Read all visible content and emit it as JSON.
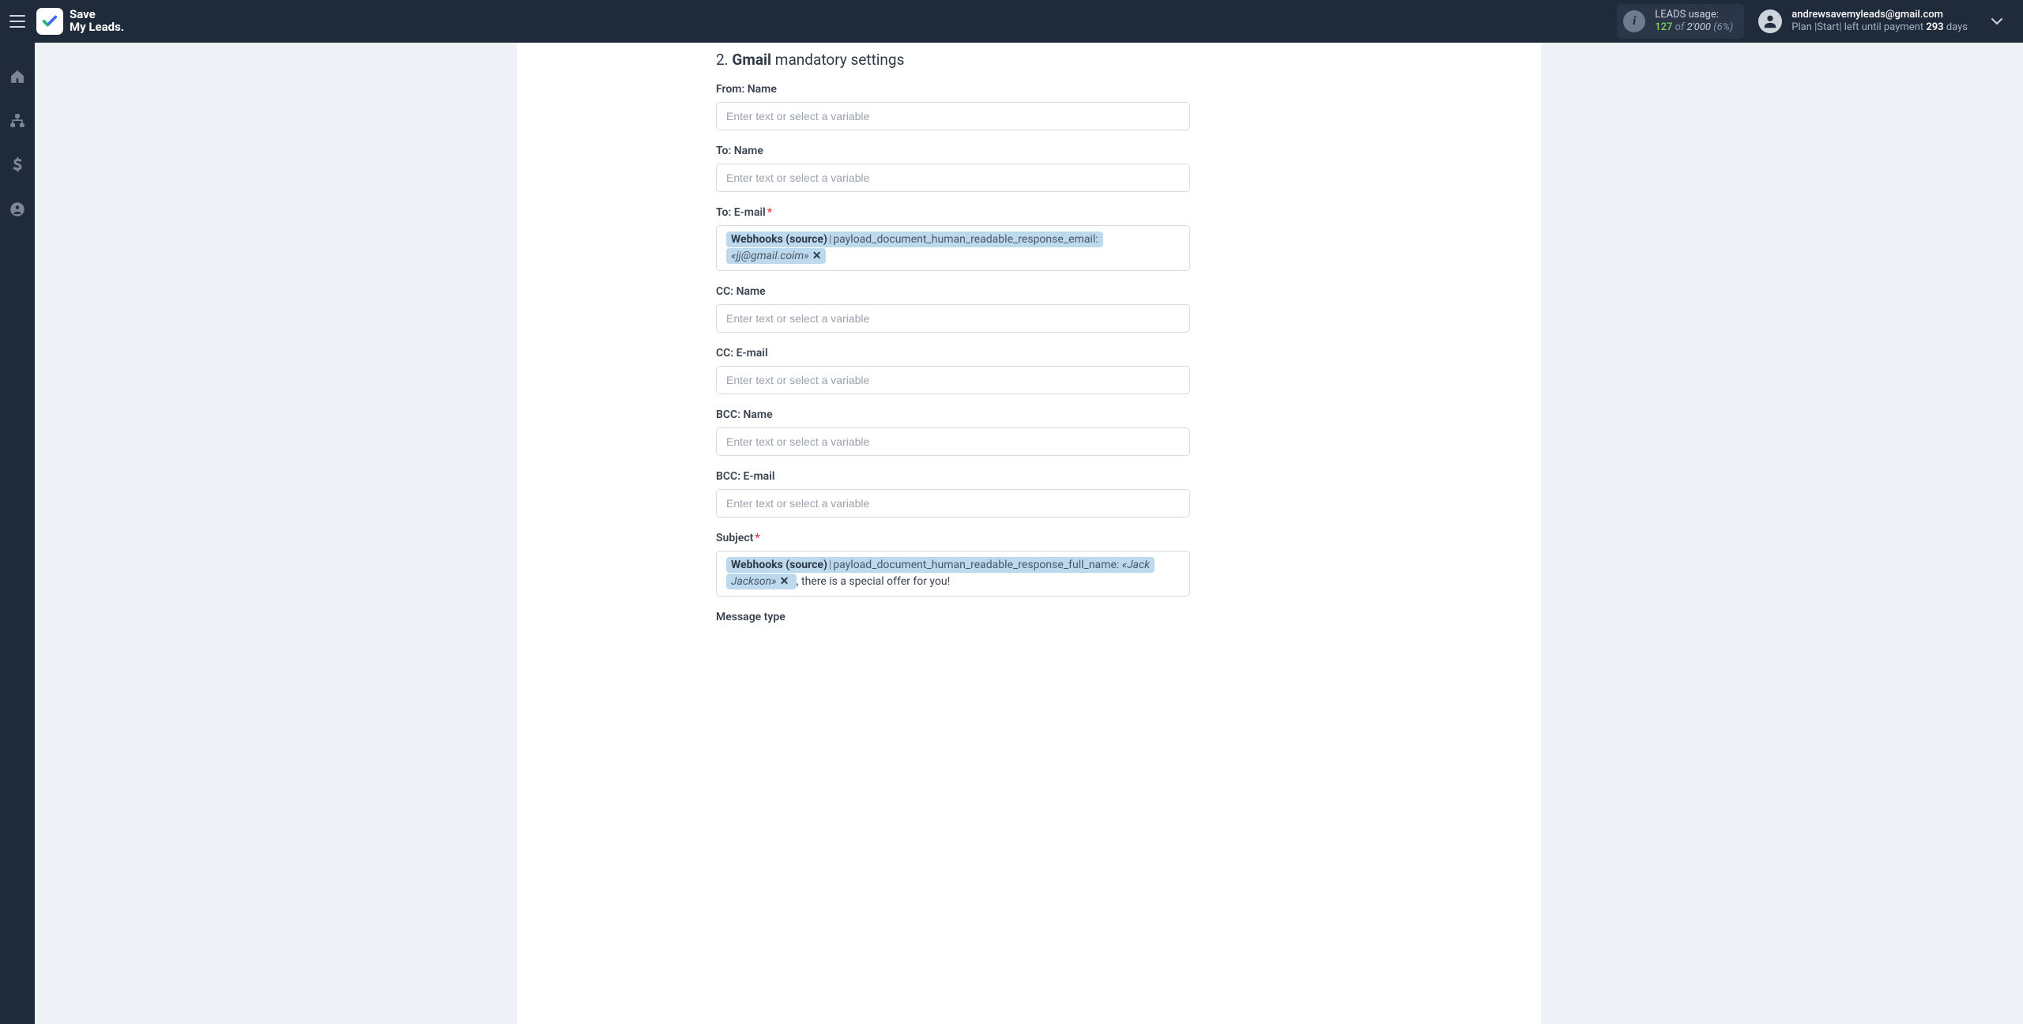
{
  "header": {
    "logo_line1": "Save",
    "logo_line2": "My Leads.",
    "usage_label": "LEADS usage:",
    "usage_count": "127",
    "usage_of": "of",
    "usage_total": "2'000",
    "usage_pct": "(6%)",
    "email": "andrewsavemyleads@gmail.com",
    "plan_prefix": "Plan |",
    "plan_name": "Start",
    "plan_mid": "| left until payment",
    "plan_days": "293",
    "plan_days_suffix": "days"
  },
  "form": {
    "section_num": "2.",
    "section_strong": "Gmail",
    "section_rest": "mandatory settings",
    "placeholder": "Enter text or select a variable",
    "fields": {
      "from_name": {
        "label": "From: Name"
      },
      "to_name": {
        "label": "To: Name"
      },
      "to_email": {
        "label": "To: E-mail",
        "required": true,
        "chip": {
          "source": "Webhooks (source)",
          "field": "payload_document_human_readable_response_email:",
          "value": "«jj@gmail.coim»"
        }
      },
      "cc_name": {
        "label": "CC: Name"
      },
      "cc_email": {
        "label": "CC: E-mail"
      },
      "bcc_name": {
        "label": "BCC: Name"
      },
      "bcc_email": {
        "label": "BCC: E-mail"
      },
      "subject": {
        "label": "Subject",
        "required": true,
        "chip": {
          "source": "Webhooks (source)",
          "field": "payload_document_human_readable_response_full_name:",
          "value": "«Jack Jackson»"
        },
        "after_text": ", there is a special offer for you!"
      },
      "message_type": {
        "label": "Message type"
      }
    }
  }
}
